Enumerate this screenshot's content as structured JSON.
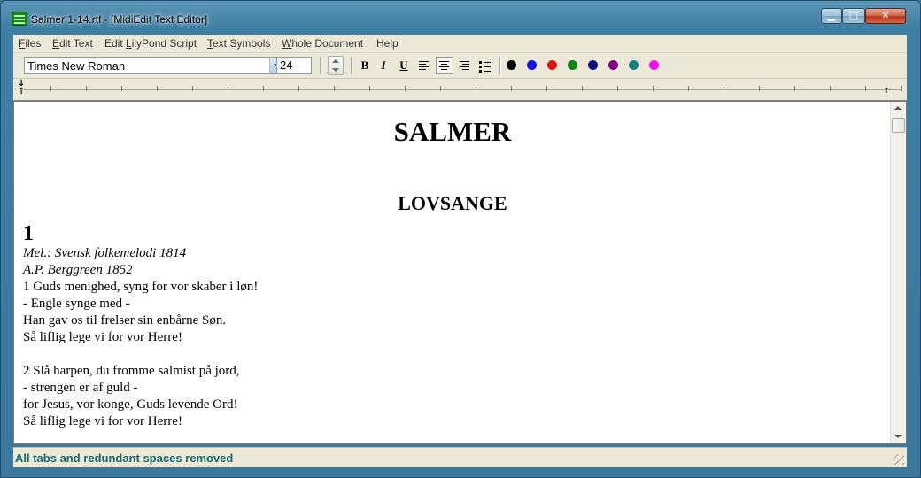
{
  "window": {
    "title": "Salmer 1-14.rtf - [MidiEdit Text Editor]"
  },
  "menu": [
    {
      "label": "Files",
      "underline": "F",
      "rest": "iles"
    },
    {
      "label": "Edit Text",
      "underline": "E",
      "rest": "dit Text"
    },
    {
      "label": "Edit LilyPond Script",
      "pre": "Edit ",
      "underline": "L",
      "rest": "ilyPond Script"
    },
    {
      "label": "Text Symbols",
      "underline": "T",
      "rest": "ext Symbols"
    },
    {
      "label": "Whole Document",
      "underline": "W",
      "rest": "hole Document"
    },
    {
      "label": "Help",
      "underline": "",
      "rest": "Help"
    }
  ],
  "toolbar": {
    "font_name": "Times New Roman",
    "font_size": "24",
    "bold_label": "B",
    "italic_label": "I",
    "underline_label": "U",
    "colors": [
      "#000000",
      "#1010e0",
      "#e01010",
      "#108010",
      "#101080",
      "#800080",
      "#108080",
      "#f010f0"
    ]
  },
  "document": {
    "title": "SALMER",
    "section": "LOVSANGE",
    "hymn_number": "1",
    "lines": [
      {
        "text": "Mel.: Svensk folkemelodi 1814",
        "italic": true
      },
      {
        "text": "A.P. Berggreen 1852",
        "italic": true
      },
      {
        "text": "1 Guds menighed, syng for vor skaber i løn!",
        "italic": false
      },
      {
        "text": "- Engle synge med -",
        "italic": false
      },
      {
        "text": "Han gav os til frelser sin enbårne Søn.",
        "italic": false
      },
      {
        "text": "Så liflig lege vi for vor Herre!",
        "italic": false
      },
      {
        "text": "",
        "italic": false
      },
      {
        "text": "2 Slå harpen, du fromme salmist på jord,",
        "italic": false
      },
      {
        "text": "- strengen er af guld -",
        "italic": false
      },
      {
        "text": "for Jesus, vor konge, Guds levende Ord!",
        "italic": false
      },
      {
        "text": "Så liflig lege vi for vor Herre!",
        "italic": false
      }
    ]
  },
  "status": {
    "text": "All tabs and redundant spaces removed"
  }
}
